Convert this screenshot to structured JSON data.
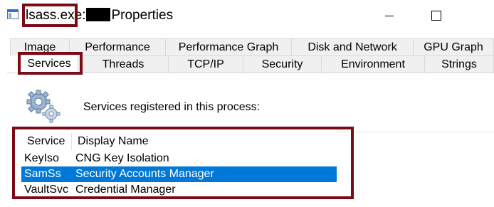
{
  "window": {
    "title_prefix": "lsass.exe:",
    "title_suffix": "Properties",
    "controls": {
      "minimize_icon": "minimize-icon",
      "maximize_icon": "maximize-icon"
    }
  },
  "tabs_row1": [
    "Image",
    "Performance",
    "Performance Graph",
    "Disk and Network",
    "GPU Graph"
  ],
  "tabs_row2": [
    "Services",
    "Threads",
    "TCP/IP",
    "Security",
    "Environment",
    "Strings"
  ],
  "active_tab": "Services",
  "services_panel": {
    "caption": "Services registered in this process:",
    "columns": [
      "Service",
      "Display Name"
    ],
    "rows": [
      {
        "service": "KeyIso",
        "display_name": "CNG Key Isolation",
        "selected": false
      },
      {
        "service": "SamSs",
        "display_name": "Security Accounts Manager",
        "selected": true
      },
      {
        "service": "VaultSvc",
        "display_name": "Credential Manager",
        "selected": false
      }
    ]
  },
  "colors": {
    "highlight_box": "#7a0a16",
    "selection": "#0078d7",
    "tab_inactive": "#f0f0f0"
  }
}
